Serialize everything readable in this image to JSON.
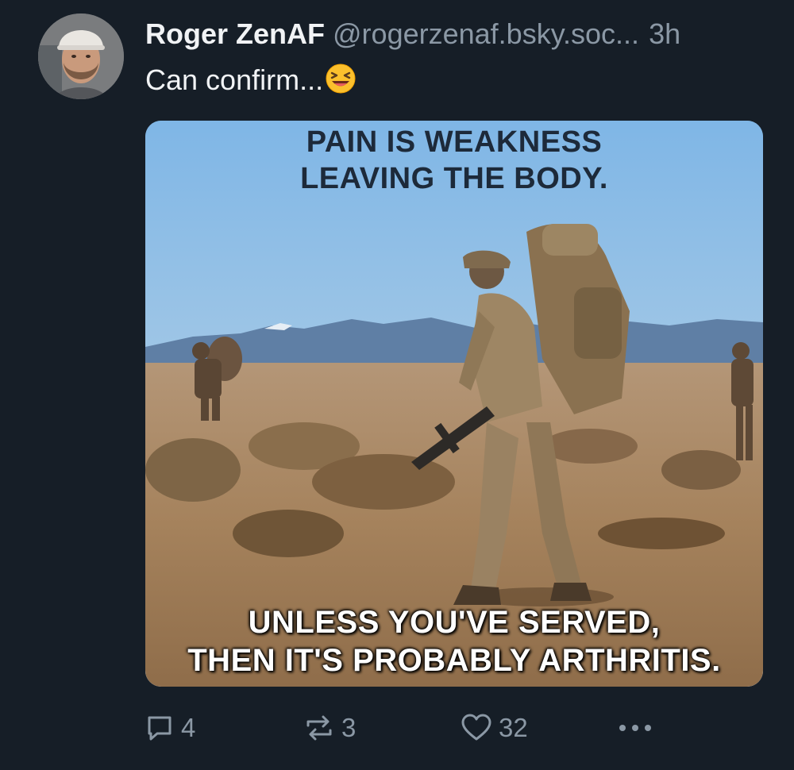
{
  "post": {
    "author": {
      "display_name": "Roger ZenAF",
      "handle": "@rogerzenaf.bsky.soc...",
      "avatar_icon": "avatar-photo"
    },
    "timestamp": "3h",
    "text": "Can confirm...",
    "emoji": "laughing-face-emoji",
    "image": {
      "caption_top": [
        "PAIN IS WEAKNESS",
        "LEAVING THE BODY."
      ],
      "caption_bottom": [
        "UNLESS YOU'VE SERVED,",
        "THEN IT'S PROBABLY ARTHRITIS."
      ]
    },
    "actions": {
      "reply_icon": "reply-icon",
      "reply_count": "4",
      "repost_icon": "repost-icon",
      "repost_count": "3",
      "like_icon": "heart-icon",
      "like_count": "32",
      "more_icon": "more-options-icon"
    }
  },
  "colors": {
    "background": "#161e27",
    "primary_text": "#f1f3f5",
    "secondary_text": "#8b98a5"
  }
}
